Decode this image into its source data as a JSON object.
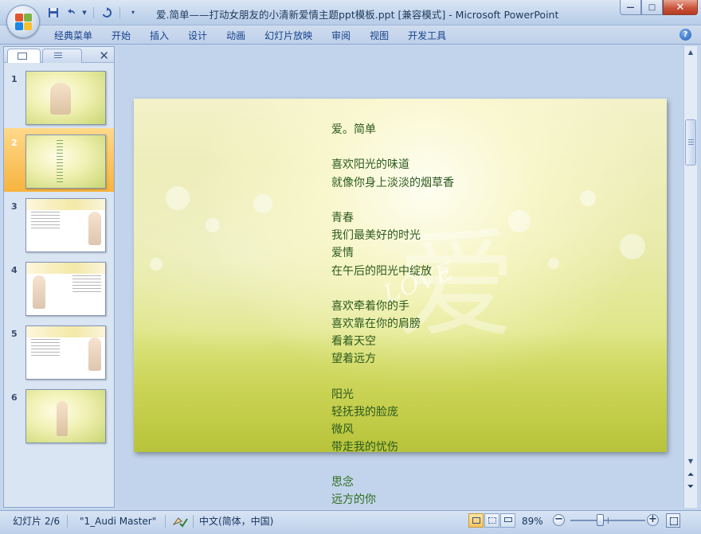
{
  "window": {
    "title": "爱.简单——打动女朋友的小清新爱情主题ppt模板.ppt [兼容模式] - Microsoft PowerPoint",
    "minimize": "—",
    "maximize": "□",
    "close": "✕"
  },
  "qat": {
    "save_icon": "save-icon",
    "undo_icon": "undo-icon",
    "redo_icon": "redo-icon",
    "customize_icon": "customize-icon"
  },
  "ribbon": {
    "tabs": [
      "经典菜单",
      "开始",
      "插入",
      "设计",
      "动画",
      "幻灯片放映",
      "审阅",
      "视图",
      "开发工具"
    ],
    "help": "?"
  },
  "left_panel": {
    "close": "✕",
    "thumbnails": [
      "1",
      "2",
      "3",
      "4",
      "5",
      "6"
    ],
    "selected": 2
  },
  "slide": {
    "lines": [
      "爱。简单",
      "",
      "喜欢阳光的味道",
      "就像你身上淡淡的烟草香",
      "",
      "青春",
      "我们最美好的时光",
      "爱情",
      "在午后的阳光中绽放",
      "",
      "喜欢牵着你的手",
      "喜欢靠在你的肩膀",
      "看着天空",
      "望着远方",
      "",
      "阳光",
      "轻抚我的脸庞",
      "微风",
      "带走我的忧伤"
    ],
    "overflow_lines": [
      "思念",
      "远方的你"
    ],
    "watermark_en": "LOVE",
    "watermark_zh": "爱"
  },
  "statusbar": {
    "slide_info": "幻灯片 2/6",
    "theme": "\"1_Audi Master\"",
    "language": "中文(简体，中国)",
    "zoom": "89%",
    "zoom_value": 89
  }
}
